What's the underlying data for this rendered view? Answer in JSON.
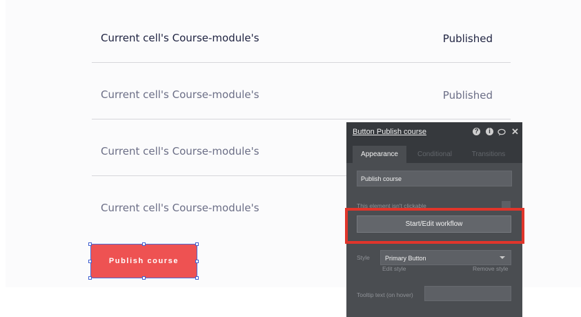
{
  "table": {
    "rows": [
      {
        "module": "Current cell's Course-module's",
        "status": "Published"
      },
      {
        "module": "Current cell's Course-module's",
        "status": "Published"
      },
      {
        "module": "Current cell's Course-module's",
        "status": ""
      },
      {
        "module": "Current cell's Course-module's",
        "status": ""
      }
    ]
  },
  "publish_button": {
    "label": "Publish course"
  },
  "inspector": {
    "title": "Button Publish course",
    "icons": [
      "help-icon",
      "info-icon",
      "comment-icon",
      "close-icon"
    ],
    "tabs": [
      "Appearance",
      "Conditional",
      "Transitions"
    ],
    "text_value": "Publish course",
    "not_clickable_label": "This element isn't clickable",
    "workflow_button": "Start/Edit workflow",
    "style_label": "Style",
    "style_value": "Primary Button",
    "edit_style": "Edit style",
    "remove_style": "Remove style",
    "tooltip_label": "Tooltip text (on hover)"
  },
  "colors": {
    "accent_red": "#ee5252",
    "highlight_red": "#e0352b",
    "panel_bg": "#4a4d51",
    "panel_header": "#36393d",
    "selection_blue": "#3f5fd0"
  }
}
